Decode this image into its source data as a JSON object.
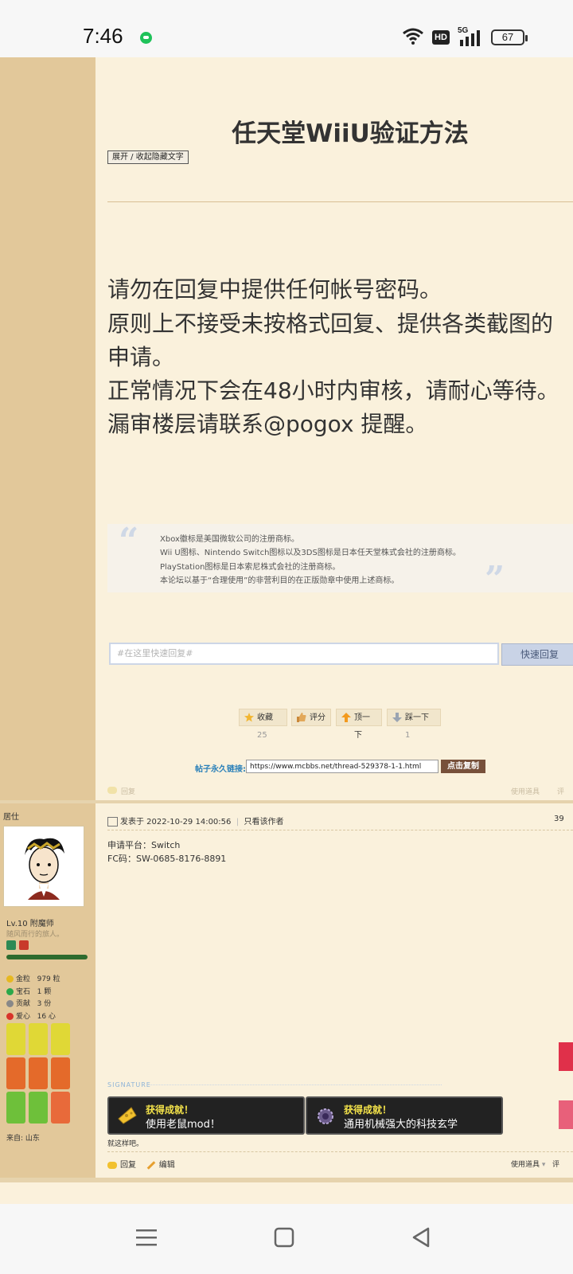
{
  "status": {
    "time": "7:46",
    "network_hd": "HD",
    "network_5g": "5G",
    "battery": "67"
  },
  "post": {
    "title": "任天堂WiiU验证方法",
    "toggle_label": "展开 / 收起隐藏文字",
    "notice_lines": [
      "请勿在回复中提供任何帐号密码。",
      "原则上不接受未按格式回复、提供各类截图的",
      "申请。",
      "正常情况下会在48小时内审核，请耐心等待。",
      "漏审楼层请联系@pogox 提醒。"
    ],
    "quote_lines": [
      "Xbox徽标是美国微软公司的注册商标。",
      "Wii U图标、Nintendo Switch图标以及3DS图标是日本任天堂株式会社的注册商标。",
      "PlayStation图标是日本索尼株式会社的注册商标。",
      "本论坛以基于“合理使用”的非营利目的在正版勋章中使用上述商标。"
    ],
    "quick_reply_placeholder": "#在这里快速回复#",
    "quick_reply_button": "快速回复",
    "actions": [
      {
        "label": "收藏",
        "count": "25"
      },
      {
        "label": "评分",
        "count": ""
      },
      {
        "label": "顶一下",
        "count": ""
      },
      {
        "label": "踩一下",
        "count": "1"
      }
    ],
    "permalink_label": "帖子永久链接:",
    "permalink_url": "https://www.mcbbs.net/thread-529378-1-1.html",
    "copy_button": "点击复制",
    "faded_reply": "回复",
    "faded_tools": "使用道具",
    "faded_rate": "评"
  },
  "reply_post": {
    "user_title": "居仕",
    "level": "Lv.10 附魔师",
    "motto": "随风而行的旅人。",
    "stats": [
      {
        "label": "金粒",
        "value": "979 粒",
        "color": "#e6b820"
      },
      {
        "label": "宝石",
        "value": "1 颗",
        "color": "#2ca84a"
      },
      {
        "label": "贡献",
        "value": "3 份",
        "color": "#888888"
      },
      {
        "label": "爱心",
        "value": "16 心",
        "color": "#d8342a"
      }
    ],
    "from": "来自:  山东",
    "meta": "发表于 2022-10-29 14:00:56",
    "only_author": "只看该作者",
    "floor": "39",
    "body_line1": "申请平台：Switch",
    "body_line2": "FC码：SW-0685-8176-8891",
    "signature_label": "SIGNATURE",
    "achievements": [
      {
        "title": "获得成就！",
        "desc": "使用老鼠mod！"
      },
      {
        "title": "获得成就！",
        "desc": "通用机械强大的科技玄学"
      }
    ],
    "signature_text": "就这样吧。",
    "reply_label": "回复",
    "edit_label": "编辑",
    "tools_label": "使用道具",
    "rate_label": "评"
  }
}
